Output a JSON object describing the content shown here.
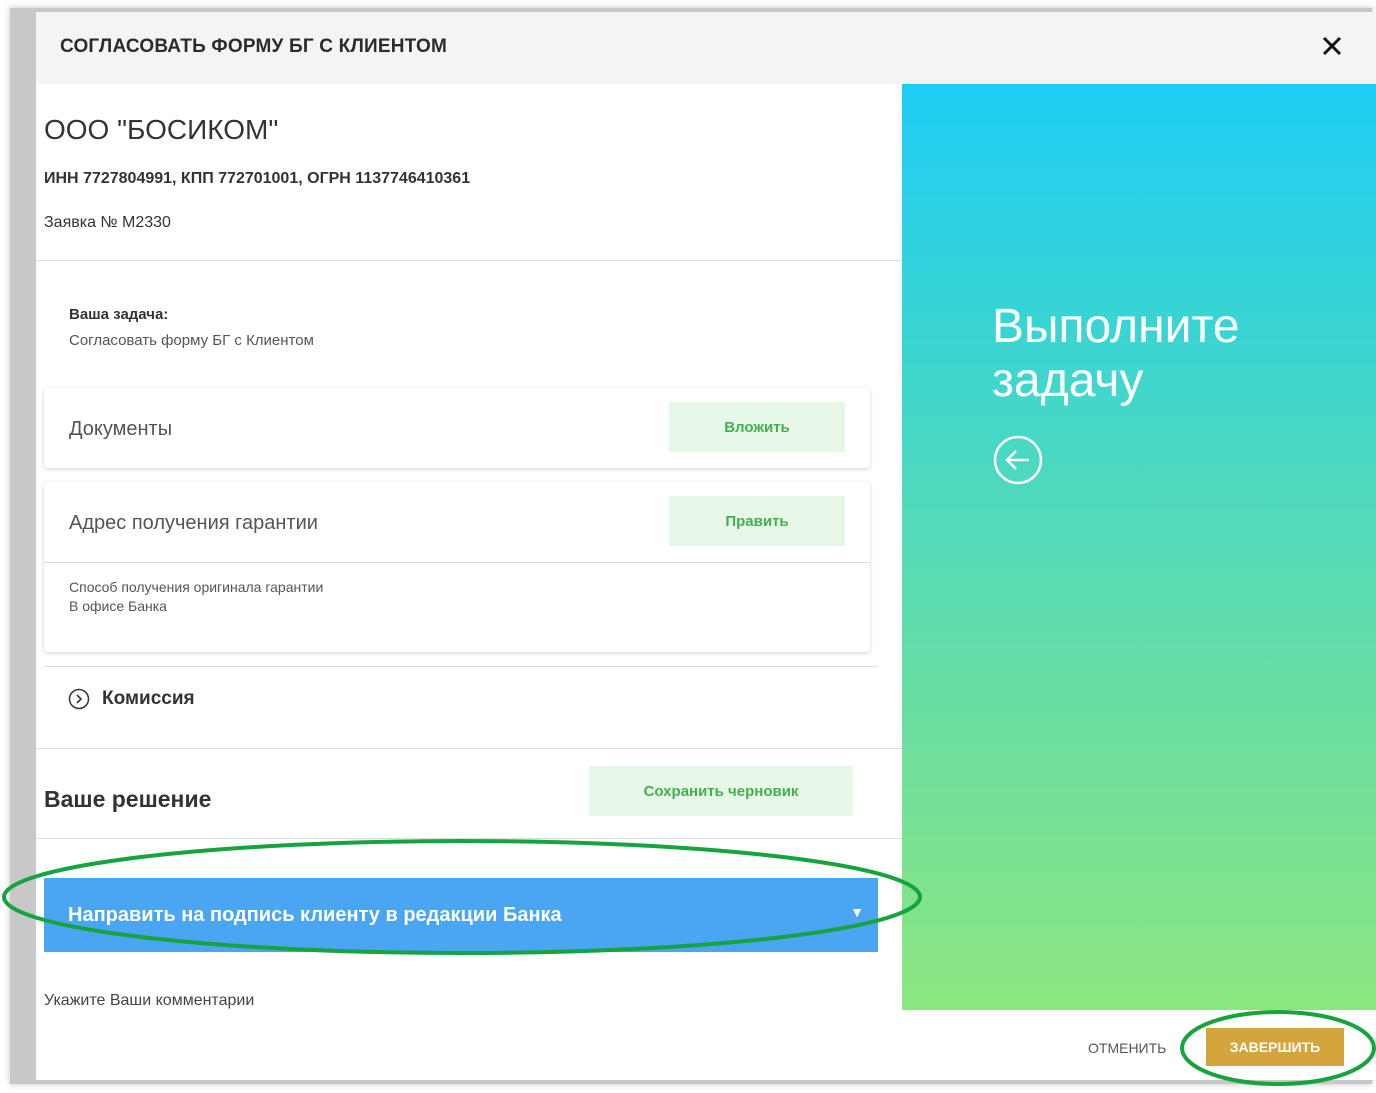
{
  "modal": {
    "title": "СОГЛАСОВАТЬ ФОРМУ БГ С КЛИЕНТОМ",
    "close_icon": "close-icon"
  },
  "company": {
    "name": "ООО \"БОСИКОМ\"",
    "ids": "ИНН 7727804991, КПП 772701001, ОГРН 1137746410361",
    "request": "Заявка № М2330"
  },
  "task": {
    "label": "Ваша задача:",
    "text": "Согласовать форму БГ с Клиентом"
  },
  "documents": {
    "title": "Документы",
    "button": "Вложить"
  },
  "address": {
    "title": "Адрес получения гарантии",
    "button": "Править",
    "detail_label": "Способ получения оригинала гарантии",
    "detail_value": "В офисе Банка"
  },
  "commission": {
    "label": "Комиссия",
    "icon": "chevron-right-circle-icon"
  },
  "decision": {
    "title": "Ваше решение",
    "save_draft": "Сохранить черновик",
    "selected": "Направить на подпись клиенту в редакции Банка",
    "arrow": "▼"
  },
  "comments": {
    "label": "Укажите Ваши комментарии",
    "value": ""
  },
  "side": {
    "heading": "Выполните задачу",
    "icon": "arrow-left-circle-icon"
  },
  "footer": {
    "cancel": "ОТМЕНИТЬ",
    "finish": "ЗАВЕРШИТЬ"
  },
  "colors": {
    "decision_bg": "#4aa5f2",
    "finish_bg": "#d4a53c",
    "green_btn_bg": "#e7f8e9",
    "green_btn_text": "#43b04e",
    "annotation": "#17a340"
  }
}
